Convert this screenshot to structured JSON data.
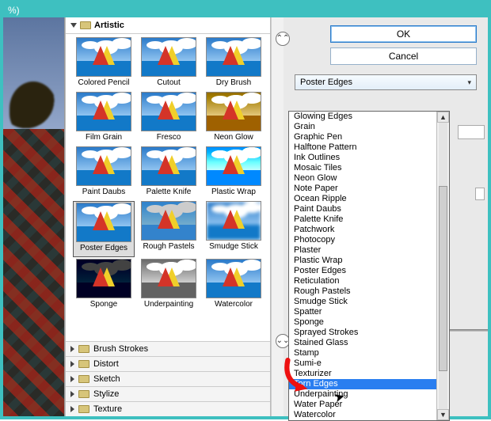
{
  "title_suffix": "%)",
  "buttons": {
    "ok": "OK",
    "cancel": "Cancel"
  },
  "combo_selected": "Poster Edges",
  "gallery": {
    "open_category": "Artistic",
    "thumbs": [
      {
        "label": "Colored Pencil",
        "variant": ""
      },
      {
        "label": "Cutout",
        "variant": ""
      },
      {
        "label": "Dry Brush",
        "variant": ""
      },
      {
        "label": "Film Grain",
        "variant": ""
      },
      {
        "label": "Fresco",
        "variant": ""
      },
      {
        "label": "Neon Glow",
        "variant": "variant-neon"
      },
      {
        "label": "Paint Daubs",
        "variant": ""
      },
      {
        "label": "Palette Knife",
        "variant": ""
      },
      {
        "label": "Plastic Wrap",
        "variant": "variant-plastic"
      },
      {
        "label": "Poster Edges",
        "variant": "",
        "selected": true
      },
      {
        "label": "Rough Pastels",
        "variant": "variant-pastel"
      },
      {
        "label": "Smudge Stick",
        "variant": "variant-smudge"
      },
      {
        "label": "Sponge",
        "variant": "variant-dark"
      },
      {
        "label": "Underpainting",
        "variant": "variant-bw"
      },
      {
        "label": "Watercolor",
        "variant": ""
      }
    ],
    "collapsed": [
      "Brush Strokes",
      "Distort",
      "Sketch",
      "Stylize",
      "Texture"
    ]
  },
  "dropdown_items": [
    "Glowing Edges",
    "Grain",
    "Graphic Pen",
    "Halftone Pattern",
    "Ink Outlines",
    "Mosaic Tiles",
    "Neon Glow",
    "Note Paper",
    "Ocean Ripple",
    "Paint Daubs",
    "Palette Knife",
    "Patchwork",
    "Photocopy",
    "Plaster",
    "Plastic Wrap",
    "Poster Edges",
    "Reticulation",
    "Rough Pastels",
    "Smudge Stick",
    "Spatter",
    "Sponge",
    "Sprayed Strokes",
    "Stained Glass",
    "Stamp",
    "Sumi-e",
    "Texturizer",
    "Torn Edges",
    "Underpainting",
    "Water Paper",
    "Watercolor"
  ],
  "dropdown_highlight": "Torn Edges"
}
